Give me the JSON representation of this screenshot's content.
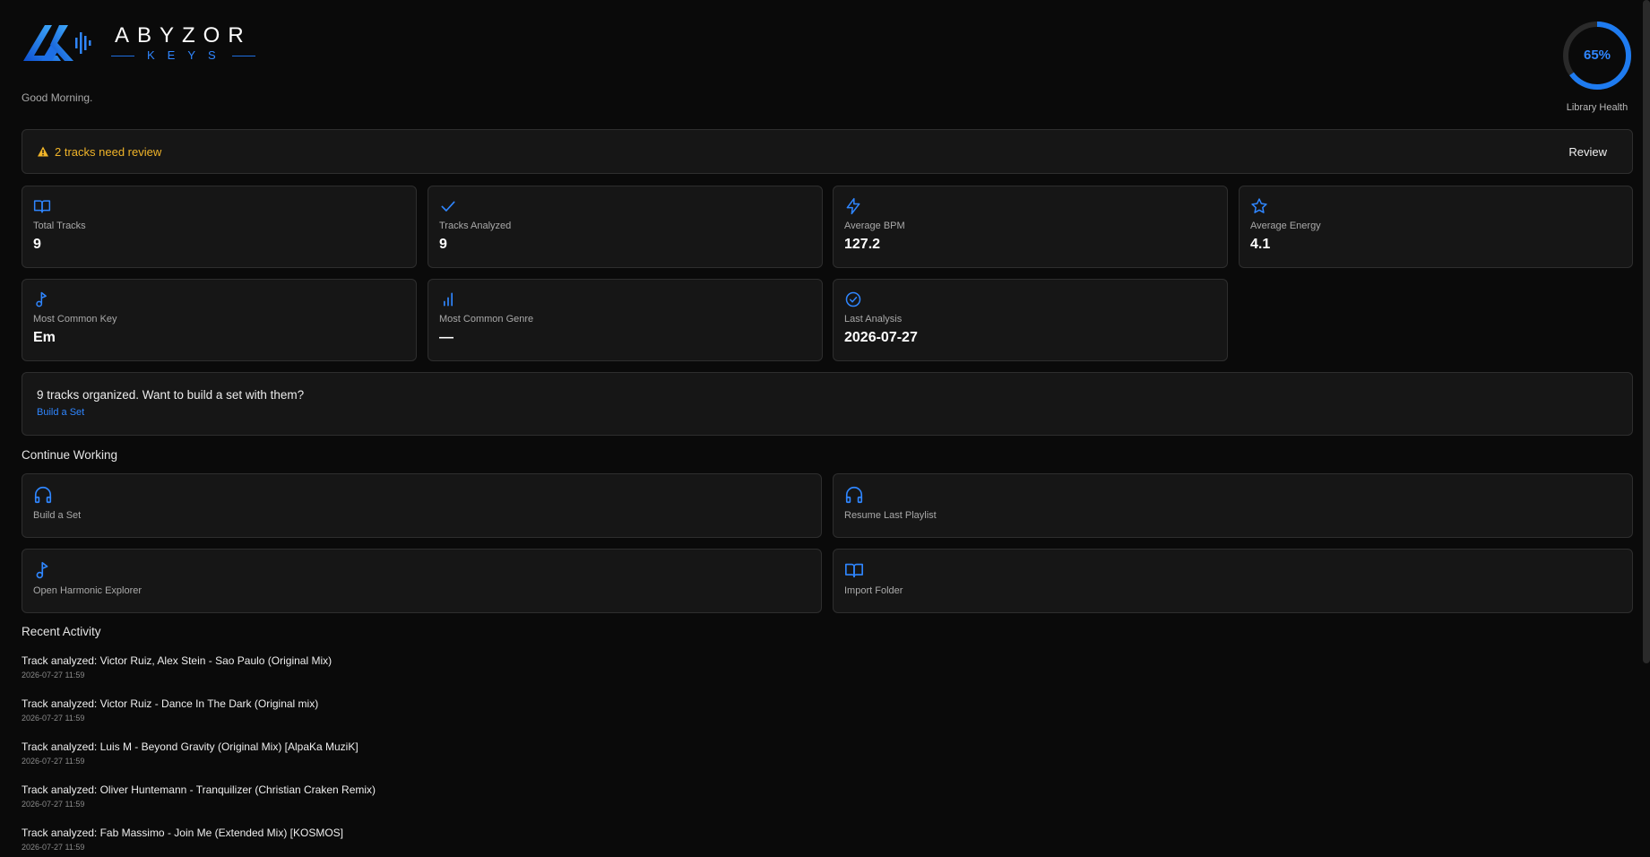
{
  "app": {
    "logo_word": "ABYZOR",
    "logo_sub": "KEYS",
    "greeting": "Good Morning."
  },
  "library_health": {
    "percent_label": "65%",
    "value": 0.65,
    "label": "Library Health",
    "color": "#1e7bf0"
  },
  "review": {
    "message": "2 tracks need review",
    "button": "Review",
    "color": "#f0b429"
  },
  "stats": [
    {
      "icon": "book-open-icon",
      "label": "Total Tracks",
      "value": "9"
    },
    {
      "icon": "check-icon",
      "label": "Tracks Analyzed",
      "value": "9"
    },
    {
      "icon": "lightning-icon",
      "label": "Average BPM",
      "value": "127.2"
    },
    {
      "icon": "star-icon",
      "label": "Average Energy",
      "value": "4.1"
    },
    {
      "icon": "music-note-icon",
      "label": "Most Common Key",
      "value": "Em"
    },
    {
      "icon": "bar-chart-icon",
      "label": "Most Common Genre",
      "value": "—"
    },
    {
      "icon": "check-circle-icon",
      "label": "Last Analysis",
      "value": "2026-07-27"
    }
  ],
  "build_prompt": {
    "text": "9 tracks organized. Want to build a set with them?",
    "link": "Build a Set"
  },
  "continue_working": {
    "title": "Continue Working",
    "actions": [
      {
        "icon": "headphones-icon",
        "label": "Build a Set"
      },
      {
        "icon": "headphones-icon",
        "label": "Resume Last Playlist"
      },
      {
        "icon": "music-note-icon",
        "label": "Open Harmonic Explorer"
      },
      {
        "icon": "book-open-icon",
        "label": "Import Folder"
      }
    ]
  },
  "recent_activity": {
    "title": "Recent Activity",
    "items": [
      {
        "title": "Track analyzed: Victor Ruiz, Alex Stein - Sao Paulo (Original Mix)",
        "time": "2026-07-27 11:59"
      },
      {
        "title": "Track analyzed: Victor Ruiz - Dance In The Dark (Original mix)",
        "time": "2026-07-27 11:59"
      },
      {
        "title": "Track analyzed: Luis M - Beyond Gravity (Original Mix) [AlpaKa MuziK]",
        "time": "2026-07-27 11:59"
      },
      {
        "title": "Track analyzed: Oliver Huntemann - Tranquilizer (Christian Craken Remix)",
        "time": "2026-07-27 11:59"
      },
      {
        "title": "Track analyzed: Fab Massimo - Join Me (Extended Mix) [KOSMOS]",
        "time": "2026-07-27 11:59"
      }
    ]
  },
  "accent_color": "#1e7bf0"
}
